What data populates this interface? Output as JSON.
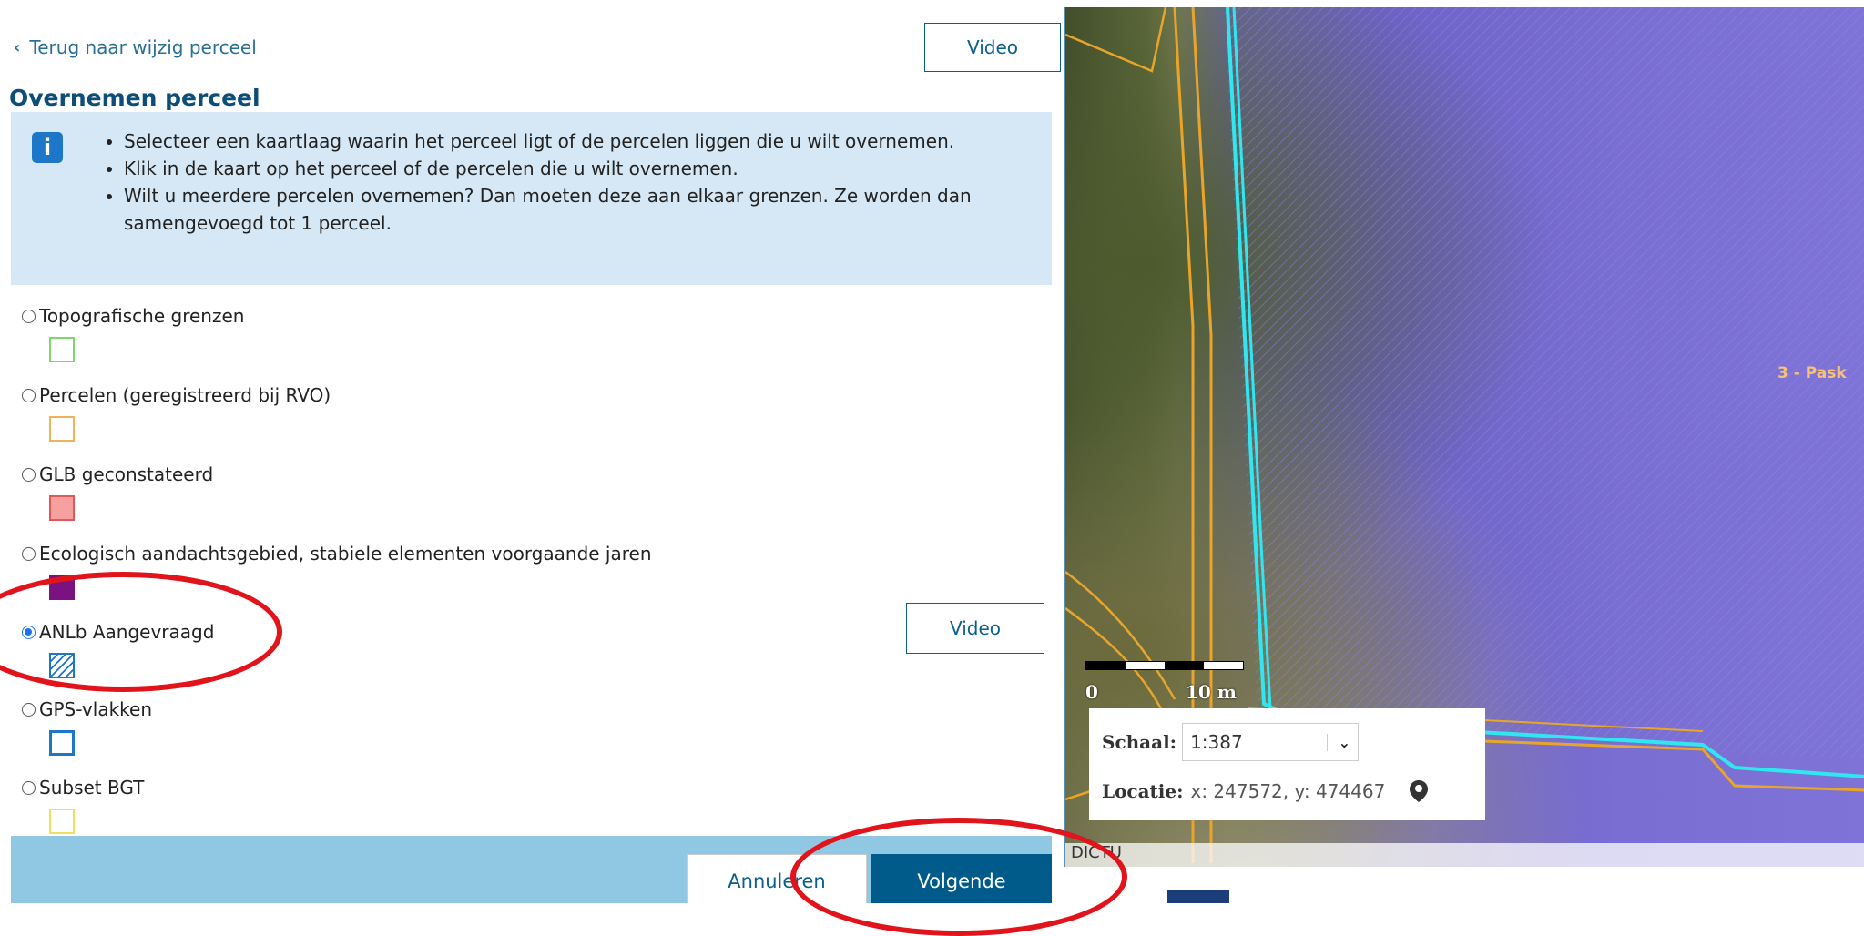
{
  "back_link": "Terug naar wijzig perceel",
  "video_label": "Video",
  "title": "Overnemen perceel",
  "info": {
    "items": [
      "Selecteer een kaartlaag waarin het perceel ligt of de percelen liggen die u wilt overnemen.",
      "Klik in de kaart op het perceel of de percelen die u wilt overnemen.",
      "Wilt u meerdere percelen overnemen? Dan moeten deze aan elkaar grenzen. Ze worden dan samengevoegd tot 1 perceel."
    ]
  },
  "layers": [
    {
      "label": "Topografische grenzen",
      "selected": false,
      "color": "#7fd66b"
    },
    {
      "label": "Percelen (geregistreerd bij RVO)",
      "selected": false,
      "color": "#f0b35a"
    },
    {
      "label": "GLB geconstateerd",
      "selected": false,
      "color": "#e05858"
    },
    {
      "label": "Ecologisch aandachtsgebied, stabiele elementen voorgaande jaren",
      "selected": false,
      "color": "#7a1280"
    },
    {
      "label": "ANLb Aangevraagd",
      "selected": true,
      "color": "#1d76c8"
    },
    {
      "label": "GPS-vlakken",
      "selected": false,
      "color": "#1d76c8"
    },
    {
      "label": "Subset BGT",
      "selected": false,
      "color": "#f0e060"
    }
  ],
  "footer": {
    "cancel": "Annuleren",
    "next": "Volgende"
  },
  "map": {
    "scale_start": "0",
    "scale_end": "10 m",
    "schaal_label": "Schaal:",
    "schaal_value": "1:387",
    "locatie_label": "Locatie:",
    "locatie_value": "x: 247572, y: 474467",
    "attribution": "DICTU",
    "parcel_label": "3 - Pask"
  }
}
